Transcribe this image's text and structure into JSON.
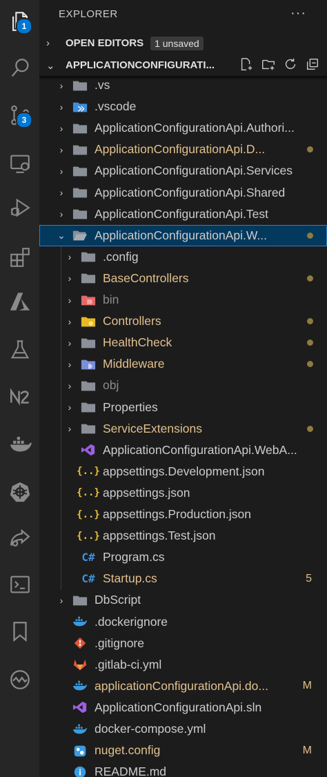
{
  "activity": {
    "explorer_badge": "1",
    "scm_badge": "3"
  },
  "explorer": {
    "title": "EXPLORER",
    "more": "···",
    "open_editors": {
      "label": "OPEN EDITORS",
      "badge": "1 unsaved"
    },
    "project": {
      "label": "APPLICATIONCONFIGURATI..."
    }
  },
  "tree": [
    {
      "label": ".vs",
      "depth": 0,
      "type": "folder",
      "color": "default",
      "chevron": "›"
    },
    {
      "label": ".vscode",
      "depth": 0,
      "type": "folder-vscode",
      "color": "default",
      "chevron": "›"
    },
    {
      "label": "ApplicationConfigurationApi.Authori...",
      "depth": 0,
      "type": "folder",
      "color": "default",
      "chevron": "›"
    },
    {
      "label": "ApplicationConfigurationApi.D...",
      "depth": 0,
      "type": "folder",
      "color": "mod",
      "chevron": "›",
      "dot": true
    },
    {
      "label": "ApplicationConfigurationApi.Services",
      "depth": 0,
      "type": "folder",
      "color": "default",
      "chevron": "›"
    },
    {
      "label": "ApplicationConfigurationApi.Shared",
      "depth": 0,
      "type": "folder",
      "color": "default",
      "chevron": "›"
    },
    {
      "label": "ApplicationConfigurationApi.Test",
      "depth": 0,
      "type": "folder",
      "color": "default",
      "chevron": "›"
    },
    {
      "label": "ApplicationConfigurationApi.W...",
      "depth": 0,
      "type": "folder-open",
      "color": "default",
      "chevron": "⌄",
      "dot": true,
      "selected": true
    },
    {
      "label": ".config",
      "depth": 1,
      "type": "folder",
      "color": "default",
      "chevron": "›"
    },
    {
      "label": "BaseControllers",
      "depth": 1,
      "type": "folder",
      "color": "mod",
      "chevron": "›",
      "dot": true
    },
    {
      "label": "bin",
      "depth": 1,
      "type": "folder-bin",
      "color": "ignored",
      "chevron": "›"
    },
    {
      "label": "Controllers",
      "depth": 1,
      "type": "folder-controllers",
      "color": "mod",
      "chevron": "›",
      "dot": true
    },
    {
      "label": "HealthCheck",
      "depth": 1,
      "type": "folder",
      "color": "mod",
      "chevron": "›",
      "dot": true
    },
    {
      "label": "Middleware",
      "depth": 1,
      "type": "folder-middleware",
      "color": "mod",
      "chevron": "›",
      "dot": true
    },
    {
      "label": "obj",
      "depth": 1,
      "type": "folder",
      "color": "ignored",
      "chevron": "›"
    },
    {
      "label": "Properties",
      "depth": 1,
      "type": "folder",
      "color": "default",
      "chevron": "›"
    },
    {
      "label": "ServiceExtensions",
      "depth": 1,
      "type": "folder",
      "color": "mod",
      "chevron": "›",
      "dot": true
    },
    {
      "label": "ApplicationConfigurationApi.WebA...",
      "depth": 1,
      "type": "vs",
      "color": "default",
      "chevron": ""
    },
    {
      "label": "appsettings.Development.json",
      "depth": 1,
      "type": "json",
      "color": "default",
      "chevron": ""
    },
    {
      "label": "appsettings.json",
      "depth": 1,
      "type": "json",
      "color": "default",
      "chevron": ""
    },
    {
      "label": "appsettings.Production.json",
      "depth": 1,
      "type": "json",
      "color": "default",
      "chevron": ""
    },
    {
      "label": "appsettings.Test.json",
      "depth": 1,
      "type": "json",
      "color": "default",
      "chevron": ""
    },
    {
      "label": "Program.cs",
      "depth": 1,
      "type": "csharp",
      "color": "default",
      "chevron": ""
    },
    {
      "label": "Startup.cs",
      "depth": 1,
      "type": "csharp",
      "color": "mod",
      "chevron": "",
      "status": "5"
    },
    {
      "label": "DbScript",
      "depth": 0,
      "type": "folder",
      "color": "default",
      "chevron": "›"
    },
    {
      "label": ".dockerignore",
      "depth": 0,
      "type": "docker",
      "color": "default",
      "chevron": ""
    },
    {
      "label": ".gitignore",
      "depth": 0,
      "type": "git",
      "color": "default",
      "chevron": ""
    },
    {
      "label": ".gitlab-ci.yml",
      "depth": 0,
      "type": "gitlab",
      "color": "default",
      "chevron": ""
    },
    {
      "label": "applicationConfigurationApi.do...",
      "depth": 0,
      "type": "docker",
      "color": "mod",
      "chevron": "",
      "status": "M"
    },
    {
      "label": "ApplicationConfigurationApi.sln",
      "depth": 0,
      "type": "vs",
      "color": "default",
      "chevron": ""
    },
    {
      "label": "docker-compose.yml",
      "depth": 0,
      "type": "docker",
      "color": "default",
      "chevron": ""
    },
    {
      "label": "nuget.config",
      "depth": 0,
      "type": "nuget",
      "color": "mod",
      "chevron": "",
      "status": "M"
    },
    {
      "label": "README.md",
      "depth": 0,
      "type": "info",
      "color": "default",
      "chevron": ""
    }
  ],
  "colors": {
    "folder": "#8a8f98",
    "accent": "#0078d4",
    "modified": "#e2c08d",
    "ignored": "#8c8c8c"
  }
}
